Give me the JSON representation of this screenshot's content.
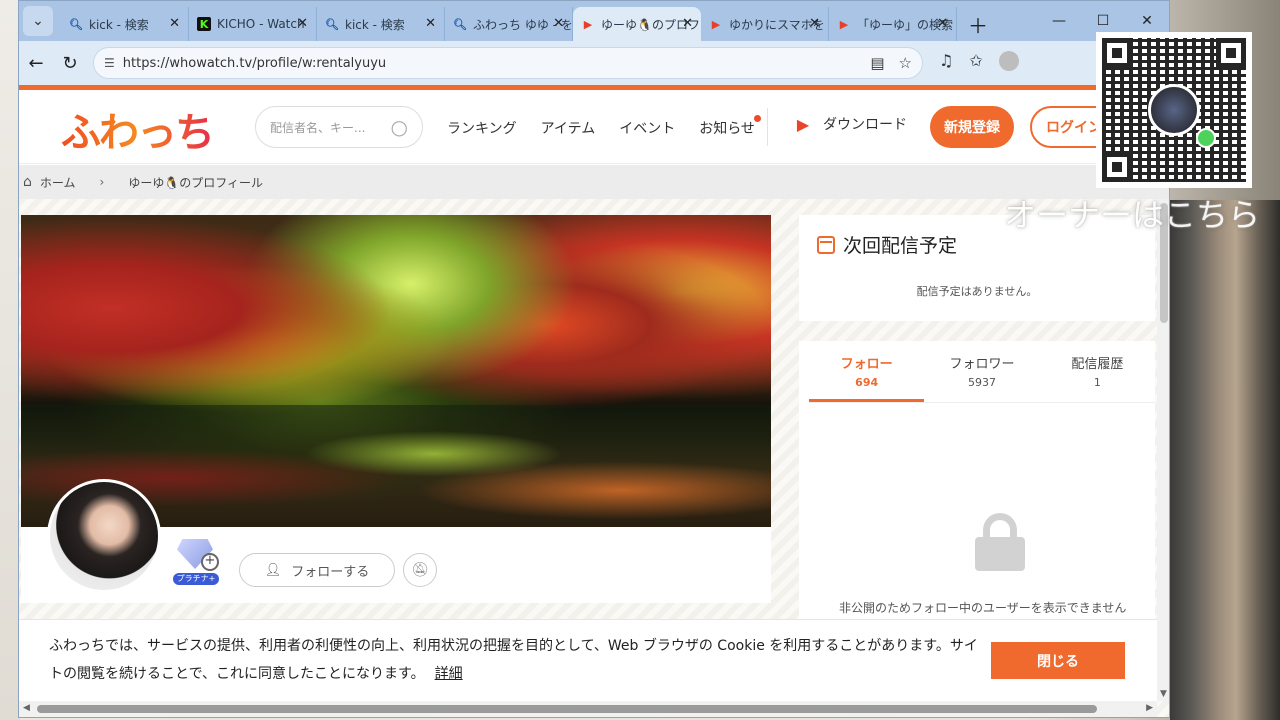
{
  "browser": {
    "tabs": [
      {
        "title": "kick - 検索",
        "favicon": "search-icon"
      },
      {
        "title": "KICHO - Watch",
        "favicon": "kick-logo-icon"
      },
      {
        "title": "kick - 検索",
        "favicon": "search-icon"
      },
      {
        "title": "ふわっち ゆゆ - を",
        "favicon": "search-icon"
      },
      {
        "title": "ゆーゆ🐧のプロフ",
        "favicon": "whowatch-icon",
        "active": true
      },
      {
        "title": "ゆかりにスマホを",
        "favicon": "whowatch-icon"
      },
      {
        "title": "「ゆーゆ」の検索",
        "favicon": "whowatch-icon"
      }
    ],
    "url": "https://whowatch.tv/profile/w:rentalyuyu"
  },
  "site": {
    "logo": "ふわっち",
    "search_placeholder": "配信者名、キー...",
    "nav": [
      "ランキング",
      "アイテム",
      "イベント",
      "お知らせ"
    ],
    "download": "ダウンロード",
    "register": "新規登録",
    "login": "ログイン"
  },
  "breadcrumb": {
    "home": "ホーム",
    "current": "ゆーゆ🐧のプロフィール"
  },
  "profile": {
    "rank_label": "プラチナ+",
    "follow_button": "フォローする"
  },
  "schedule": {
    "title": "次回配信予定",
    "empty": "配信予定はありません。"
  },
  "stats": {
    "tabs": [
      {
        "label": "フォロー",
        "count": "694"
      },
      {
        "label": "フォロワー",
        "count": "5937"
      },
      {
        "label": "配信履歴",
        "count": "1"
      }
    ],
    "private_message": "非公開のためフォロー中のユーザーを表示できません"
  },
  "cookie": {
    "text": "ふわっちでは、サービスの提供、利用者の利便性の向上、利用状況の把握を目的として、Web ブラウザの Cookie を利用することがあります。サイトの閲覧を続けることで、これに同意したことになります。",
    "details": "詳細",
    "close": "閉じる"
  },
  "overlay": {
    "caption": "オーナーはこちら"
  },
  "colors": {
    "accent": "#ef6a2c",
    "tabbar": "#a9c4e4"
  }
}
